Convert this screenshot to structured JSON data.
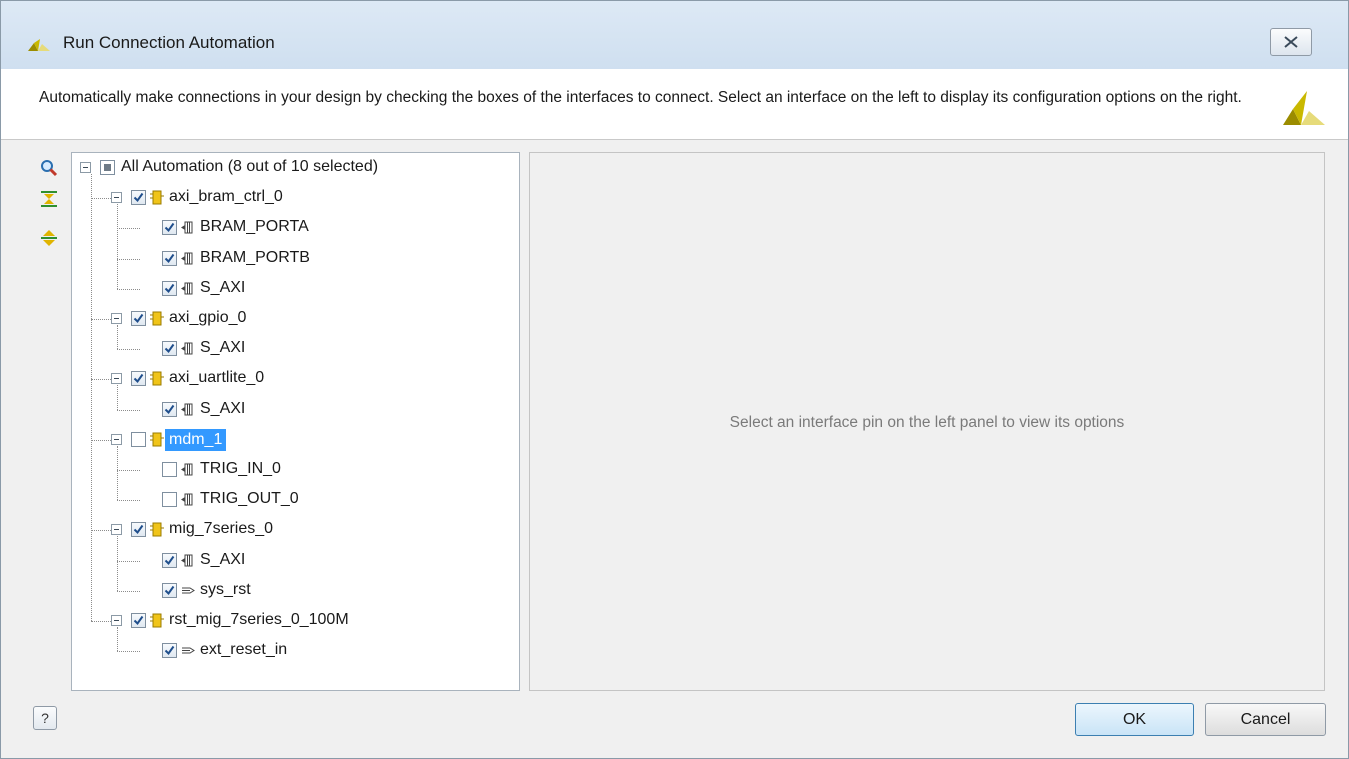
{
  "window": {
    "title": "Run Connection Automation",
    "description": "Automatically make connections in your design by checking the boxes of the interfaces to connect. Select an interface on the left to display its configuration options on the right."
  },
  "toolbar": {
    "icons": [
      "search-icon",
      "collapse-all-icon",
      "expand-all-icon"
    ]
  },
  "tree": {
    "root": {
      "label": "All Automation (8 out of 10 selected)",
      "state": "partial"
    },
    "nodes": [
      {
        "label": "axi_bram_ctrl_0",
        "checked": true,
        "children": [
          {
            "label": "BRAM_PORTA",
            "checked": true,
            "icon": "interface-icon"
          },
          {
            "label": "BRAM_PORTB",
            "checked": true,
            "icon": "interface-icon"
          },
          {
            "label": "S_AXI",
            "checked": true,
            "icon": "interface-icon"
          }
        ]
      },
      {
        "label": "axi_gpio_0",
        "checked": true,
        "children": [
          {
            "label": "S_AXI",
            "checked": true,
            "icon": "interface-icon"
          }
        ]
      },
      {
        "label": "axi_uartlite_0",
        "checked": true,
        "children": [
          {
            "label": "S_AXI",
            "checked": true,
            "icon": "interface-icon"
          }
        ]
      },
      {
        "label": "mdm_1",
        "checked": false,
        "selected": true,
        "children": [
          {
            "label": "TRIG_IN_0",
            "checked": false,
            "icon": "interface-icon"
          },
          {
            "label": "TRIG_OUT_0",
            "checked": false,
            "icon": "interface-icon"
          }
        ]
      },
      {
        "label": "mig_7series_0",
        "checked": true,
        "children": [
          {
            "label": "S_AXI",
            "checked": true,
            "icon": "interface-icon"
          },
          {
            "label": "sys_rst",
            "checked": true,
            "icon": "pin-icon"
          }
        ]
      },
      {
        "label": "rst_mig_7series_0_100M",
        "checked": true,
        "children": [
          {
            "label": "ext_reset_in",
            "checked": true,
            "icon": "pin-icon"
          }
        ]
      }
    ]
  },
  "right_panel": {
    "message": "Select an interface pin on the left panel to view its options"
  },
  "buttons": {
    "help": "?",
    "ok": "OK",
    "cancel": "Cancel"
  },
  "colors": {
    "selection": "#3399ff",
    "title_gradient_top": "#dde9f5",
    "logo": "#c7b800"
  }
}
